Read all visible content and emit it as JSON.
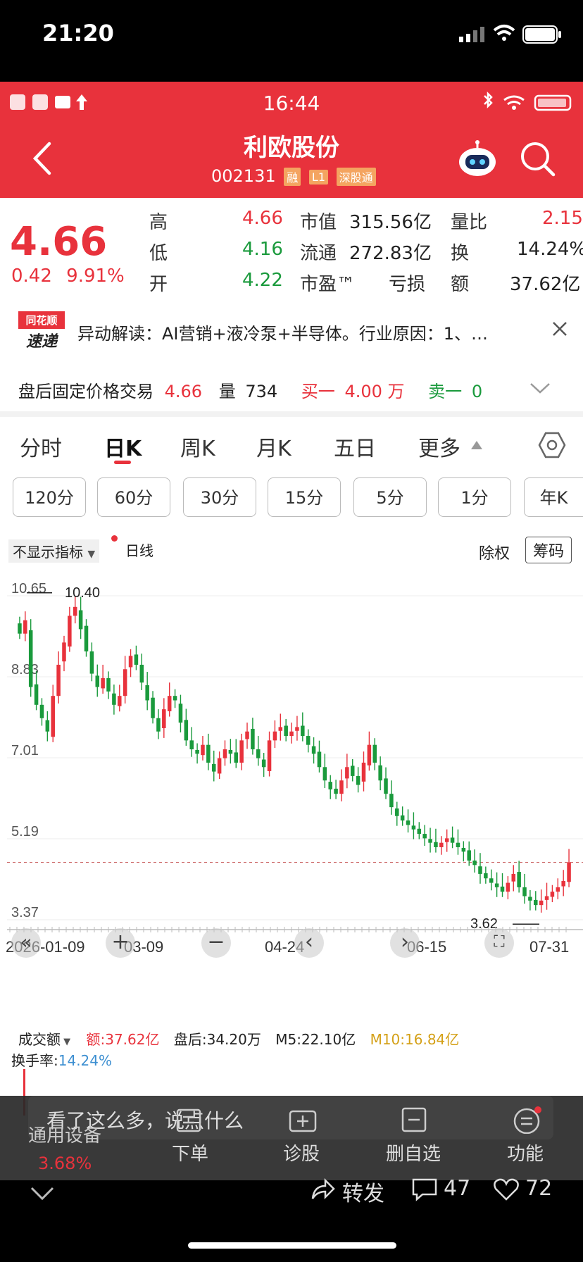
{
  "outer_status": {
    "time": "21:20"
  },
  "inner_status": {
    "time": "16:44"
  },
  "header": {
    "title": "利欧股份",
    "code": "002131",
    "tags": [
      "融",
      "L1",
      "深股通"
    ]
  },
  "quote": {
    "price": "4.66",
    "change": "0.42",
    "change_pct": "9.91%",
    "high_label": "高",
    "high": "4.66",
    "low_label": "低",
    "low": "4.16",
    "open_label": "开",
    "open": "4.22",
    "mktcap_label": "市值",
    "mktcap": "315.56亿",
    "float_label": "流通",
    "float": "272.83亿",
    "pe_label": "市盈™",
    "pe": "亏损",
    "vol_ratio_label": "量比",
    "vol_ratio": "2.15",
    "turnover_label": "换",
    "turnover": "14.24%",
    "amount_label": "额",
    "amount": "37.62亿"
  },
  "news": {
    "badge_top": "同花顺",
    "badge_bottom": "速递",
    "text": "异动解读：AI营销+液冷泵+半导体。行业原因：1、…"
  },
  "fixed_trade": {
    "label": "盘后固定价格交易",
    "price": "4.66",
    "vol_label": "量",
    "vol": "734",
    "buy_label": "买一",
    "buy": "4.00 万",
    "sell_label": "卖一",
    "sell": "0"
  },
  "tabs": [
    "分时",
    "日K",
    "周K",
    "月K",
    "五日",
    "更多"
  ],
  "periods": [
    "120分",
    "60分",
    "30分",
    "15分",
    "5分",
    "1分",
    "年K"
  ],
  "chart_toolbar": {
    "indicator": "不显示指标",
    "line": "日线",
    "adjust": "除权",
    "chips": "筹码"
  },
  "chart_data": {
    "type": "candlestick",
    "y_ticks": [
      "10.65",
      "8.83",
      "7.01",
      "5.19",
      "3.37"
    ],
    "x_ticks": [
      "2026-01-09",
      "03-09",
      "04-24",
      "06-15",
      "07-31"
    ],
    "max_label": "10.40",
    "min_label": "3.62",
    "ylim": [
      3.37,
      10.65
    ],
    "closes": [
      9.8,
      10.1,
      8.6,
      8.2,
      7.9,
      7.6,
      8.4,
      9.1,
      9.6,
      10.2,
      10.4,
      9.9,
      9.4,
      8.9,
      8.6,
      8.8,
      8.5,
      8.2,
      8.4,
      9.0,
      9.3,
      9.1,
      8.7,
      8.3,
      7.9,
      7.6,
      8.1,
      8.4,
      8.3,
      7.8,
      7.4,
      7.2,
      7.1,
      7.3,
      6.9,
      6.7,
      7.0,
      7.2,
      7.1,
      6.9,
      7.4,
      7.6,
      7.2,
      7.0,
      6.8,
      7.4,
      7.6,
      7.7,
      7.5,
      7.6,
      7.7,
      7.5,
      7.3,
      7.1,
      6.8,
      6.5,
      6.3,
      6.2,
      6.5,
      6.8,
      6.6,
      6.4,
      6.9,
      7.3,
      6.9,
      6.5,
      6.2,
      5.9,
      5.7,
      5.6,
      5.5,
      5.4,
      5.3,
      5.2,
      5.1,
      5.0,
      5.1,
      5.2,
      5.1,
      5.0,
      4.9,
      4.7,
      4.6,
      4.4,
      4.3,
      4.2,
      4.1,
      4.0,
      4.2,
      4.4,
      4.1,
      3.9,
      3.8,
      3.7,
      3.8,
      3.9,
      4.0,
      4.1,
      4.24,
      4.66
    ],
    "volume_max": "37.62亿"
  },
  "chart_controls": [
    "«",
    "+",
    "−",
    "‹",
    "›",
    "⛶"
  ],
  "volume": {
    "label": "成交额",
    "amount": "额:37.62亿",
    "after": "盘后:34.20万",
    "m5": "M5:22.10亿",
    "m10": "M10:16.84亿",
    "turnover_label": "换手率:",
    "turnover": "14.24%"
  },
  "bottom_bar": {
    "comment_placeholder": "看了这么多，说点什么",
    "items": [
      "下单",
      "诊股",
      "删自选",
      "功能"
    ],
    "left_label": "通用设备",
    "left_value": "3.68%"
  },
  "social": {
    "share": "转发",
    "comments": "47",
    "likes": "72"
  },
  "colors": {
    "red": "#e8323c",
    "green": "#1a9a3c"
  }
}
